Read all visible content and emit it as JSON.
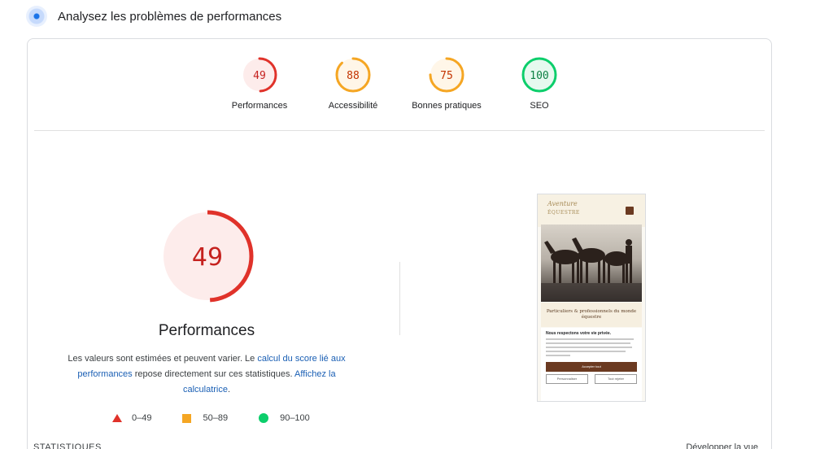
{
  "header": {
    "icon": "audit-icon",
    "title": "Analysez les problèmes de performances"
  },
  "gauges": [
    {
      "score": "49",
      "value": 49,
      "label": "Performances",
      "color": "#e0322a",
      "bg": "#fdeceb"
    },
    {
      "score": "88",
      "value": 88,
      "label": "Accessibilité",
      "color": "#f5a623",
      "bg": "#fff6e8"
    },
    {
      "score": "75",
      "value": 75,
      "label": "Bonnes pratiques",
      "color": "#f5a623",
      "bg": "#fff6e8"
    },
    {
      "score": "100",
      "value": 100,
      "label": "SEO",
      "color": "#0cce6b",
      "bg": "#e6f9ef"
    }
  ],
  "main": {
    "score": "49",
    "value": 49,
    "title": "Performances",
    "desc_part1": "Les valeurs sont estimées et peuvent varier. Le ",
    "link_score": "calcul du score lié aux performances",
    "desc_part2": " repose directement sur ces statistiques. ",
    "link_calc": "Affichez la calculatrice",
    "desc_part3": "."
  },
  "legend": [
    {
      "shape": "triangle",
      "range": "0–49"
    },
    {
      "shape": "square",
      "range": "50–89"
    },
    {
      "shape": "circle",
      "range": "90–100"
    }
  ],
  "phone": {
    "logo_line1": "Aventure",
    "logo_line2": "ÉQUESTRE",
    "caption": "Particuliers & professionnels du monde équestre",
    "cookie_title": "Nous respectons votre vie privée.",
    "accept": "Accepter tout",
    "customize": "Personnaliser",
    "reject": "Tout rejeter"
  },
  "footer": {
    "stats": "STATISTIQUES",
    "expand": "Développer la vue"
  }
}
